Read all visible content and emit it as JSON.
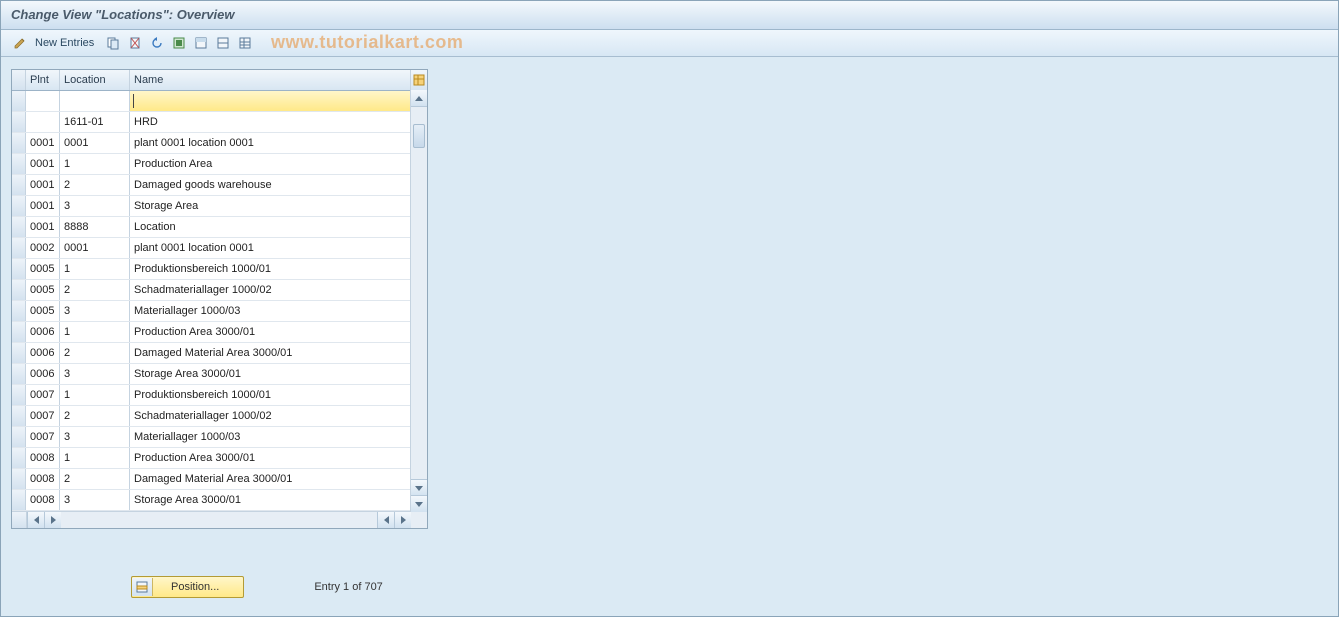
{
  "title": "Change View \"Locations\": Overview",
  "watermark": "www.tutorialkart.com",
  "toolbar": {
    "new_entries_label": "New Entries"
  },
  "table": {
    "headers": {
      "plnt": "Plnt",
      "location": "Location",
      "name": "Name"
    },
    "rows": [
      {
        "plnt": "",
        "location": "",
        "name": "",
        "input": true
      },
      {
        "plnt": "",
        "location": "1611-01",
        "name": "HRD"
      },
      {
        "plnt": "0001",
        "location": "0001",
        "name": "plant 0001 location 0001"
      },
      {
        "plnt": "0001",
        "location": "1",
        "name": "Production Area"
      },
      {
        "plnt": "0001",
        "location": "2",
        "name": "Damaged goods warehouse"
      },
      {
        "plnt": "0001",
        "location": "3",
        "name": "Storage Area"
      },
      {
        "plnt": "0001",
        "location": "8888",
        "name": "Location"
      },
      {
        "plnt": "0002",
        "location": "0001",
        "name": "plant 0001 location 0001"
      },
      {
        "plnt": "0005",
        "location": "1",
        "name": "Produktionsbereich 1000/01"
      },
      {
        "plnt": "0005",
        "location": "2",
        "name": "Schadmateriallager 1000/02"
      },
      {
        "plnt": "0005",
        "location": "3",
        "name": "Materiallager 1000/03"
      },
      {
        "plnt": "0006",
        "location": "1",
        "name": "Production Area 3000/01"
      },
      {
        "plnt": "0006",
        "location": "2",
        "name": "Damaged Material Area 3000/01"
      },
      {
        "plnt": "0006",
        "location": "3",
        "name": "Storage Area  3000/01"
      },
      {
        "plnt": "0007",
        "location": "1",
        "name": "Produktionsbereich 1000/01"
      },
      {
        "plnt": "0007",
        "location": "2",
        "name": "Schadmateriallager 1000/02"
      },
      {
        "plnt": "0007",
        "location": "3",
        "name": "Materiallager 1000/03"
      },
      {
        "plnt": "0008",
        "location": "1",
        "name": "Production Area 3000/01"
      },
      {
        "plnt": "0008",
        "location": "2",
        "name": "Damaged Material Area 3000/01"
      },
      {
        "plnt": "0008",
        "location": "3",
        "name": "Storage Area  3000/01"
      }
    ]
  },
  "footer": {
    "position_label": "Position...",
    "entry_info": "Entry 1 of 707"
  }
}
